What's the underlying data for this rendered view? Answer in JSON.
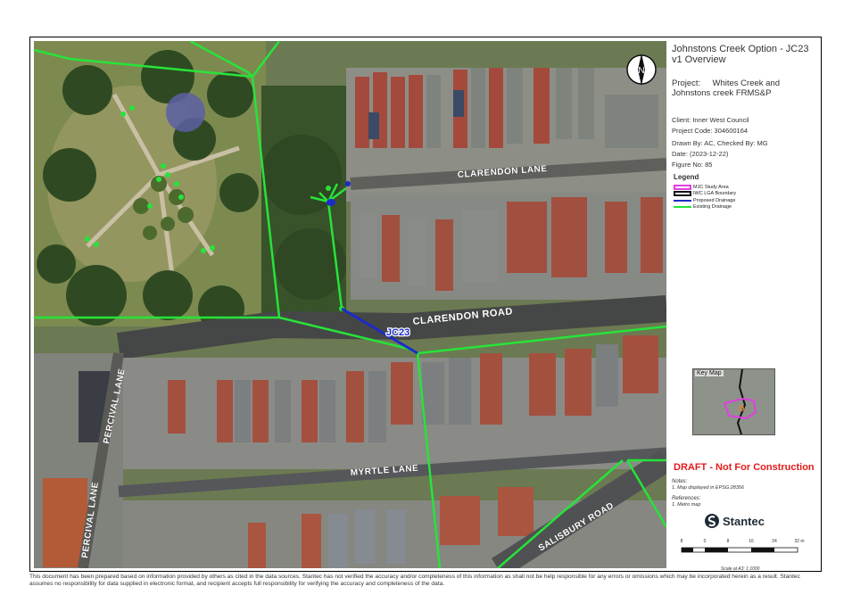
{
  "map": {
    "road_labels": {
      "clarendon_lane": "CLARENDON LANE",
      "clarendon_road": "CLARENDON ROAD",
      "percival_lane_1": "PERCIVAL LANE",
      "percival_lane_2": "PERCIVAL LANE",
      "myrtle_lane": "MYRTLE LANE",
      "salisbury_road": "SALISBURY ROAD"
    },
    "pipe_label": "JC23",
    "north_letter": "N",
    "colors": {
      "existing_drainage": "#27e33a",
      "proposed_drainage": "#1c2bc9",
      "pipe_label_text": "#1c2bc9",
      "draft": "#e31b1b"
    }
  },
  "panel": {
    "title": "Johnstons Creek Option - JC23 v1 Overview",
    "project_label": "Project:",
    "project_value": "Whites Creek and Johnstons creek FRMS&P",
    "client": "Client:  Inner West Council",
    "project_code": "Project Code:  304600164",
    "drawn_by": "Drawn By:  AC, Checked By: MG",
    "date": "Date:  (2023-12-22)",
    "figure_no": "Figure No:  85",
    "legend": {
      "title": "Legend",
      "items": [
        {
          "label": "MJC Study Area",
          "color": "#e040e0",
          "kind": "box-magenta"
        },
        {
          "label": "IWC LGA Boundary",
          "color": "#111111",
          "kind": "box-black"
        },
        {
          "label": "Proposed Drainage",
          "color": "#1c2bc9",
          "kind": "line"
        },
        {
          "label": "Existing Drainage",
          "color": "#27e33a",
          "kind": "line"
        }
      ]
    },
    "key_map_label": "Key Map",
    "draft_label": "DRAFT - Not For Construction",
    "notes_heading": "Notes:",
    "notes_1": "1. Map displayed in EPSG:28356",
    "references_heading": "References:",
    "references_1": "1. Metro map",
    "logo_text": "Stantec",
    "scale_ticks": [
      "8",
      "0",
      "8",
      "16",
      "24",
      "32 m"
    ],
    "scale_text": "Scale at A3: 1:1000"
  },
  "disclaimer": "This document has been prepared based on information provided by others as cited in the data sources. Stantec has not verified the accuracy and/or completeness of this information as shall not be help responsible for any errors or omissions which may be incorporated herein as a result. Stantec assumes no responsibility for data supplied in electronic format, and recipient accepts full responsibility for verifying the accuracy and completeness of the data."
}
